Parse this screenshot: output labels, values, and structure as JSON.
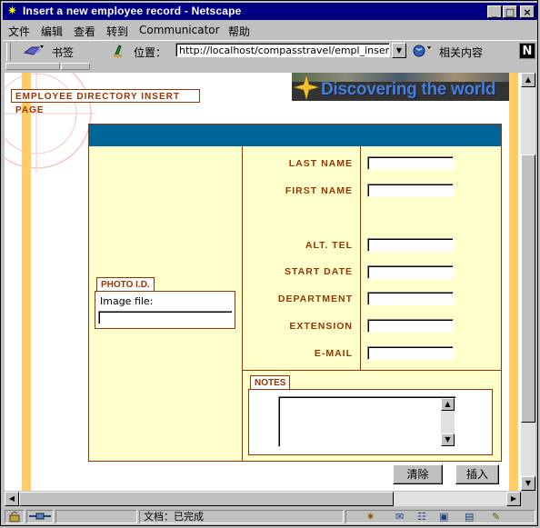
{
  "window": {
    "title": "Insert a new employee record - Netscape",
    "minimize": "_",
    "maximize": "□",
    "close": "×"
  },
  "menu": [
    "文件",
    "编辑",
    "查看",
    "转到",
    "Communicator",
    "帮助"
  ],
  "toolbar": {
    "bookmarks_label": "书签",
    "location_label": "位置：",
    "url": "http://localhost/compasstravel/empl_insert.asp",
    "related_label": "相关内容"
  },
  "page": {
    "header_title": "EMPLOYEE DIRECTORY INSERT PAGE",
    "banner_text": "Discovering the world",
    "photo_title": "PHOTO I.D.",
    "image_file_label": "Image file:",
    "fields": {
      "last_name": "LAST NAME",
      "first_name": "FIRST NAME",
      "alt_tel": "ALT. TEL",
      "start_date": "START DATE",
      "department": "DEPARTMENT",
      "extension": "EXTENSION",
      "email": "E-MAIL"
    },
    "notes_title": "NOTES",
    "clear_button": "清除",
    "insert_button": "插入"
  },
  "status": {
    "text": "文档：已完成"
  },
  "colors": {
    "title_bar": "#000080",
    "accent_brown": "#993300",
    "form_bg": "#ffffcc",
    "form_header": "#00669a",
    "strip": "#ffcc66"
  }
}
